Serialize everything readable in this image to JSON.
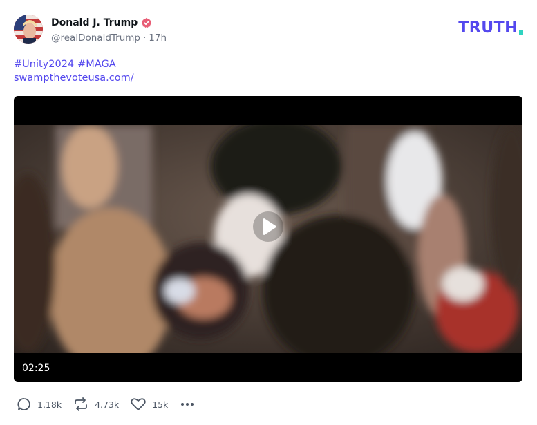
{
  "author": {
    "display_name": "Donald J. Trump",
    "handle": "@realDonaldTrump",
    "separator": "·",
    "time_ago": "17h",
    "verified_icon": "verified-badge-icon"
  },
  "brand": {
    "logo_text": "TRUTH",
    "logo_color": "#5448ee",
    "dot_color": "#2fd3c0"
  },
  "post": {
    "hashtags": [
      "#Unity2024",
      "#MAGA"
    ],
    "link": "swampthevoteusa.com/"
  },
  "video": {
    "duration": "02:25",
    "play_icon": "play-icon"
  },
  "actions": {
    "replies": "1.18k",
    "retruths": "4.73k",
    "likes": "15k",
    "more_icon": "more-dots-icon"
  },
  "colors": {
    "accent": "#5448ee",
    "verified": "#e85d75"
  }
}
